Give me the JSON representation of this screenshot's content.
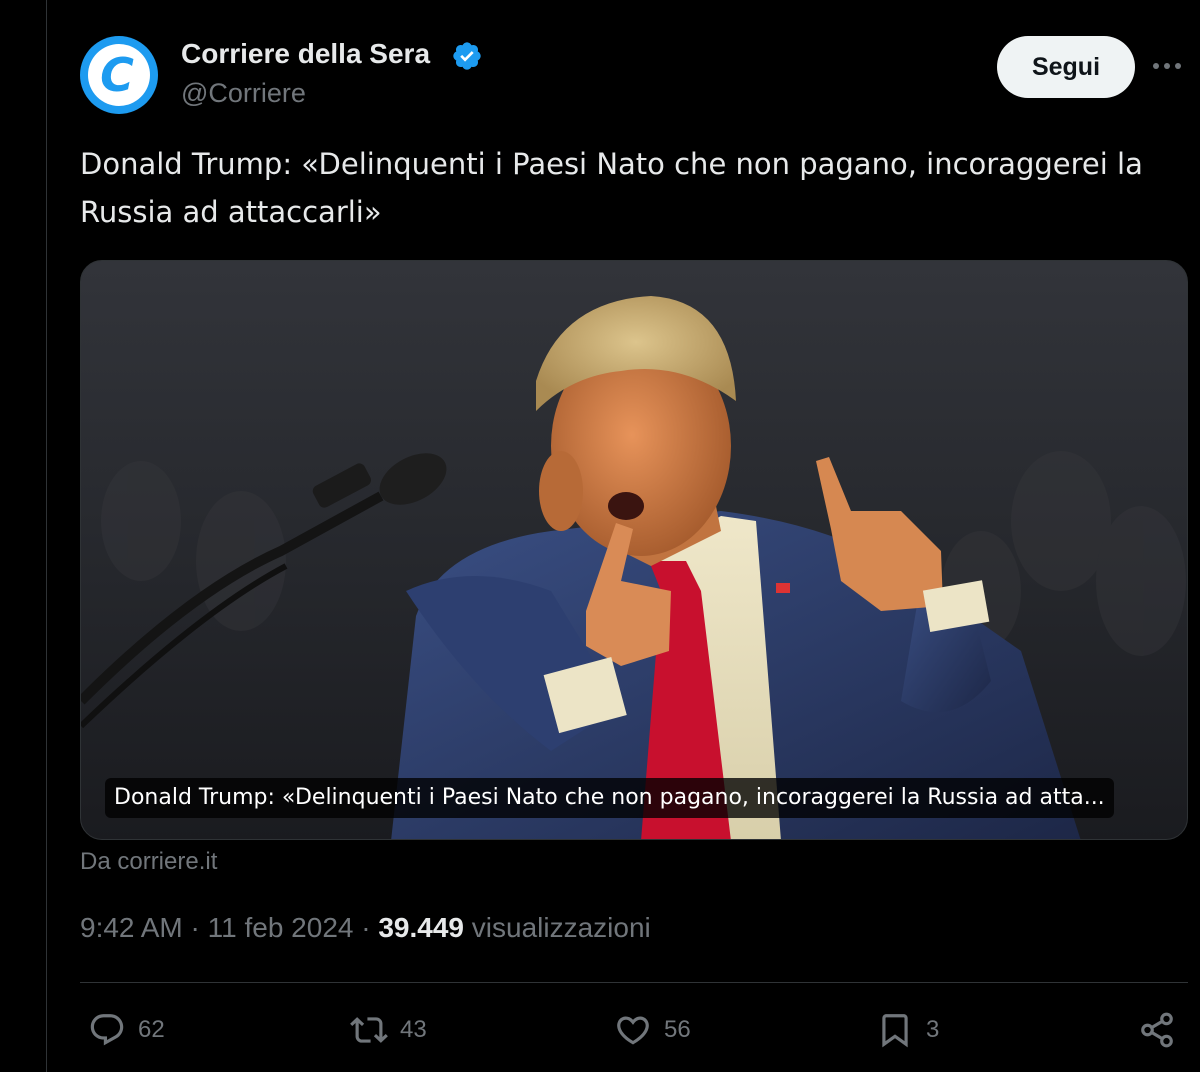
{
  "author": {
    "name": "Corriere della Sera",
    "handle": "@Corriere",
    "avatar_letter": "C",
    "verified": true
  },
  "follow_label": "Segui",
  "tweet_text": "Donald Trump: «Delinquenti i Paesi Nato che non pagano, incoraggerei la Russia ad attaccarli»",
  "card": {
    "caption": "Donald Trump: «Delinquenti i Paesi Nato che non pagano, incoraggerei la Russia ad atta...",
    "source": "Da corriere.it"
  },
  "meta": {
    "time": "9:42 AM",
    "sep1": " · ",
    "date": "11 feb 2024",
    "sep2": " · ",
    "views": "39.449",
    "views_label": " visualizzazioni"
  },
  "actions": {
    "replies": "62",
    "retweets": "43",
    "likes": "56",
    "bookmarks": "3"
  },
  "colors": {
    "accent": "#1d9bf0",
    "text": "#e7e9ea",
    "muted": "#71767b",
    "tie": "#c8102e"
  },
  "icons": [
    "verified-badge-icon",
    "more-icon",
    "reply-icon",
    "retweet-icon",
    "like-icon",
    "bookmark-icon",
    "share-icon"
  ]
}
